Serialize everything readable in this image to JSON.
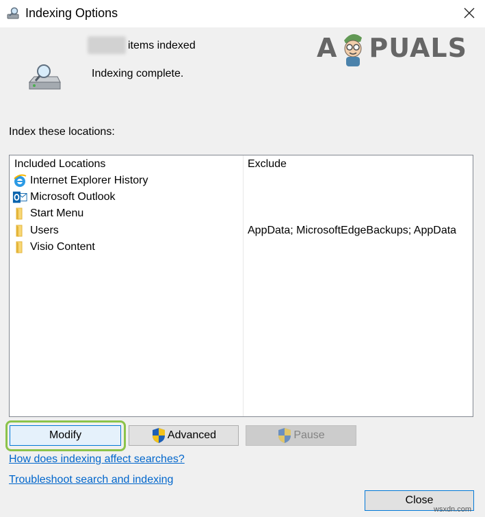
{
  "window": {
    "title": "Indexing Options",
    "close_icon": "close-icon"
  },
  "status": {
    "items_suffix": "items indexed",
    "message": "Indexing complete."
  },
  "watermark": {
    "text_left": "A",
    "text_right": "PUALS"
  },
  "locations": {
    "label": "Index these locations:",
    "headers": {
      "included": "Included Locations",
      "exclude": "Exclude"
    },
    "rows": [
      {
        "name": "Internet Explorer History",
        "icon": "ie-icon",
        "exclude": ""
      },
      {
        "name": "Microsoft Outlook",
        "icon": "outlook-icon",
        "exclude": ""
      },
      {
        "name": "Start Menu",
        "icon": "folder-icon",
        "exclude": ""
      },
      {
        "name": "Users",
        "icon": "folder-icon",
        "exclude": "AppData; MicrosoftEdgeBackups; AppData"
      },
      {
        "name": "Visio Content",
        "icon": "folder-icon",
        "exclude": ""
      }
    ]
  },
  "buttons": {
    "modify": "Modify",
    "advanced": "Advanced",
    "pause": "Pause",
    "close": "Close"
  },
  "links": {
    "affect": "How does indexing affect searches?",
    "troubleshoot": "Troubleshoot search and indexing"
  },
  "footer": {
    "site": "wsxdn.com"
  }
}
